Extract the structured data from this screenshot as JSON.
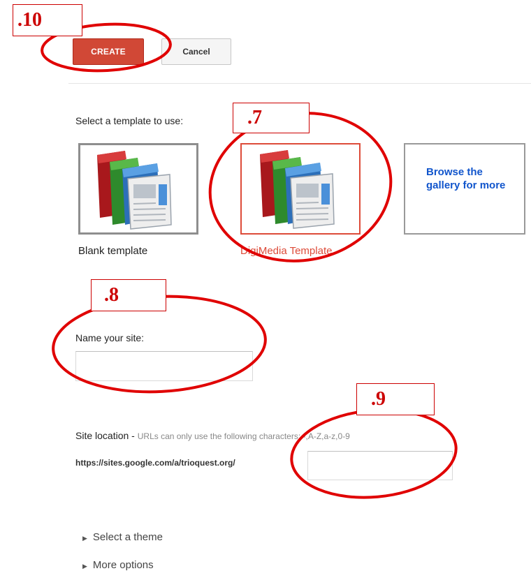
{
  "buttons": {
    "create": "CREATE",
    "cancel": "Cancel"
  },
  "template_section": {
    "label": "Select a template to use:"
  },
  "templates": [
    {
      "caption": "Blank template",
      "icon": "sites-template-icon"
    },
    {
      "caption": "DigiMedia Template",
      "icon": "sites-template-icon",
      "selected": true
    },
    {
      "caption": "Browse the gallery for more"
    }
  ],
  "name_section": {
    "label": "Name your site:",
    "value": ""
  },
  "location_section": {
    "label": "Site location",
    "separator": " - ",
    "hint": "URLs can only use the following characters: -,A-Z,a-z,0-9",
    "url_prefix": "https://sites.google.com/a/trioquest.org/",
    "value": ""
  },
  "options": [
    {
      "label": "Select a theme"
    },
    {
      "label": "More options"
    }
  ],
  "annotations": {
    "a10": ".10",
    "a7": ".7",
    "a8": ".8",
    "a9": ".9"
  },
  "colors": {
    "create_button": "#d14836",
    "selected_border": "#dd4b39",
    "link": "#1155cc",
    "annotation": "#cc0000"
  }
}
